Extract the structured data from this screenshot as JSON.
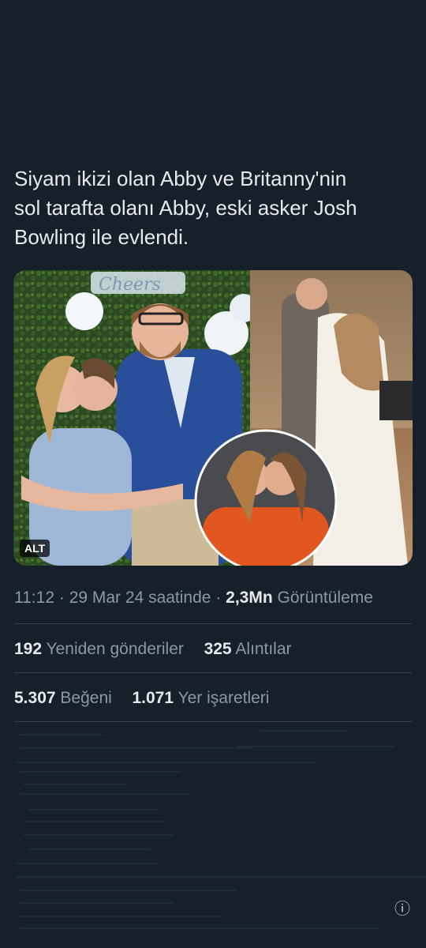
{
  "tweet": {
    "text": "Siyam ikizi olan Abby ve Britanny'nin\nsol tarafta olanı Abby, eski asker Josh\nBowling ile evlendi."
  },
  "media": {
    "alt_badge": "ALT",
    "sign_text": "Cheers"
  },
  "meta": {
    "time": "11:12",
    "separator": "·",
    "date": "29 Mar 24 saatinde",
    "views_count": "2,3Mn",
    "views_label": "Görüntüleme"
  },
  "stats": {
    "reposts_count": "192",
    "reposts_label": "Yeniden gönderiler",
    "quotes_count": "325",
    "quotes_label": "Alıntılar",
    "likes_count": "5.307",
    "likes_label": "Beğeni",
    "bookmarks_count": "1.071",
    "bookmarks_label": "Yer işaretleri"
  },
  "icons": {
    "info": "info-icon"
  },
  "colors": {
    "background": "#15202b",
    "primary_text": "#e7e9ea",
    "secondary_text": "#8b98a5",
    "divider": "#38444d"
  }
}
